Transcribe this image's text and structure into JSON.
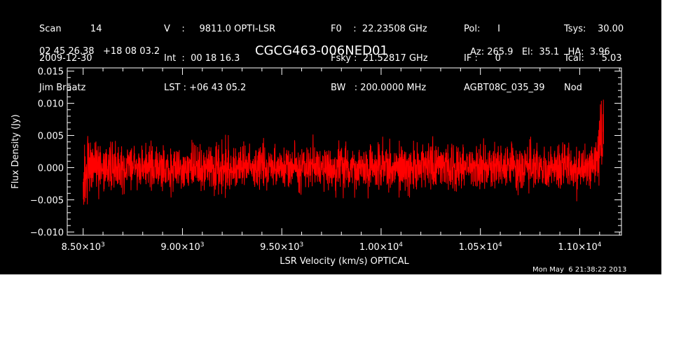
{
  "header": {
    "col1": [
      "Scan          14",
      "2009-12-30",
      "Jim Braatz"
    ],
    "col2": [
      "V    :     9811.0 OPTI-LSR",
      "Int  :  00 18 16.3",
      "LST : +06 43 05.2"
    ],
    "col3": [
      "F0    :  22.23508 GHz",
      "Fsky :  21.52817 GHz",
      "BW   : 200.0000 MHz"
    ],
    "col4": [
      "Pol:      I",
      "IF :      0",
      "AGBT08C_035_39"
    ],
    "col5": [
      "Tsys:    30.00",
      "Tcal:      5.03",
      "Nod"
    ],
    "coords": "02 45 26.38   +18 08 03.2",
    "source": "CGCG463-006NED01",
    "azelha": "Az: 265.9   El:  35.1   HA:  3.96",
    "timestamp": "Mon May  6 21:38:22 2013"
  },
  "colors": {
    "background": "#000000",
    "axes": "#ffffff",
    "trace": "#ff0000",
    "page": "#ffffff"
  },
  "chart_data": {
    "type": "line",
    "title": "CGCG463-006NED01",
    "xlabel": "LSR Velocity (km/s) OPTICAL",
    "ylabel": "Flux Density (Jy)",
    "xlim": [
      8420,
      11210
    ],
    "ylim": [
      -0.0105,
      0.0155
    ],
    "x_ticks": [
      {
        "value": 8500,
        "mant": "8.50",
        "exp": "3"
      },
      {
        "value": 9000,
        "mant": "9.00",
        "exp": "3"
      },
      {
        "value": 9500,
        "mant": "9.50",
        "exp": "3"
      },
      {
        "value": 10000,
        "mant": "1.00",
        "exp": "4"
      },
      {
        "value": 10500,
        "mant": "1.05",
        "exp": "4"
      },
      {
        "value": 11000,
        "mant": "1.10",
        "exp": "4"
      }
    ],
    "x_minor_step": 100,
    "y_ticks": [
      {
        "value": 0.015,
        "label": "0.015"
      },
      {
        "value": 0.01,
        "label": "0.010"
      },
      {
        "value": 0.005,
        "label": "0.005"
      },
      {
        "value": 0.0,
        "label": "0.000"
      },
      {
        "value": -0.005,
        "label": "−0.005"
      },
      {
        "value": -0.01,
        "label": "−0.010"
      }
    ],
    "y_minor_step": 0.001,
    "series": [
      {
        "x_start": 8500,
        "x_end": 11120,
        "n_points": 2600,
        "noise_rms": 0.0025,
        "baseline": 0.0,
        "envelope": [
          [
            8500,
            -0.003
          ],
          [
            8520,
            0.0
          ],
          [
            11050,
            0.0
          ],
          [
            11090,
            0.002
          ],
          [
            11120,
            0.006
          ]
        ],
        "noise_boost": [
          [
            8500,
            1.5
          ],
          [
            8540,
            1.0
          ],
          [
            11060,
            1.0
          ],
          [
            11120,
            1.6
          ]
        ]
      }
    ]
  }
}
